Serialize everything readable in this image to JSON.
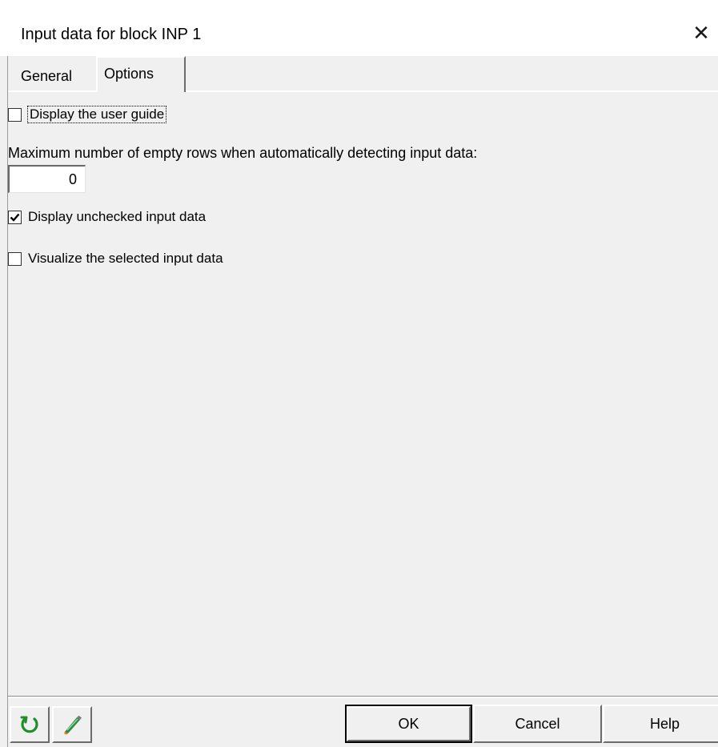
{
  "window": {
    "title": "Input data for block INP 1",
    "close_glyph": "✕"
  },
  "tabs": [
    {
      "label": "General",
      "selected": false
    },
    {
      "label": "Options",
      "selected": true
    }
  ],
  "options": {
    "display_user_guide": {
      "label": "Display the user guide",
      "checked": false
    },
    "max_empty_rows": {
      "label": "Maximum number of empty rows when automatically detecting input data:",
      "value": "0"
    },
    "display_unchecked": {
      "label": "Display unchecked input data",
      "checked": true
    },
    "visualize_selected": {
      "label": "Visualize the selected input data",
      "checked": false
    }
  },
  "footer": {
    "reset_icon": "refresh-icon",
    "clear_icon": "eraser-icon",
    "ok_label": "OK",
    "cancel_label": "Cancel",
    "help_label": "Help"
  },
  "colors": {
    "background": "#f0f0f0",
    "reset_icon": "#1f8f2a",
    "eraser_body": "#2e8b3e",
    "eraser_tip": "#ff6a00"
  }
}
